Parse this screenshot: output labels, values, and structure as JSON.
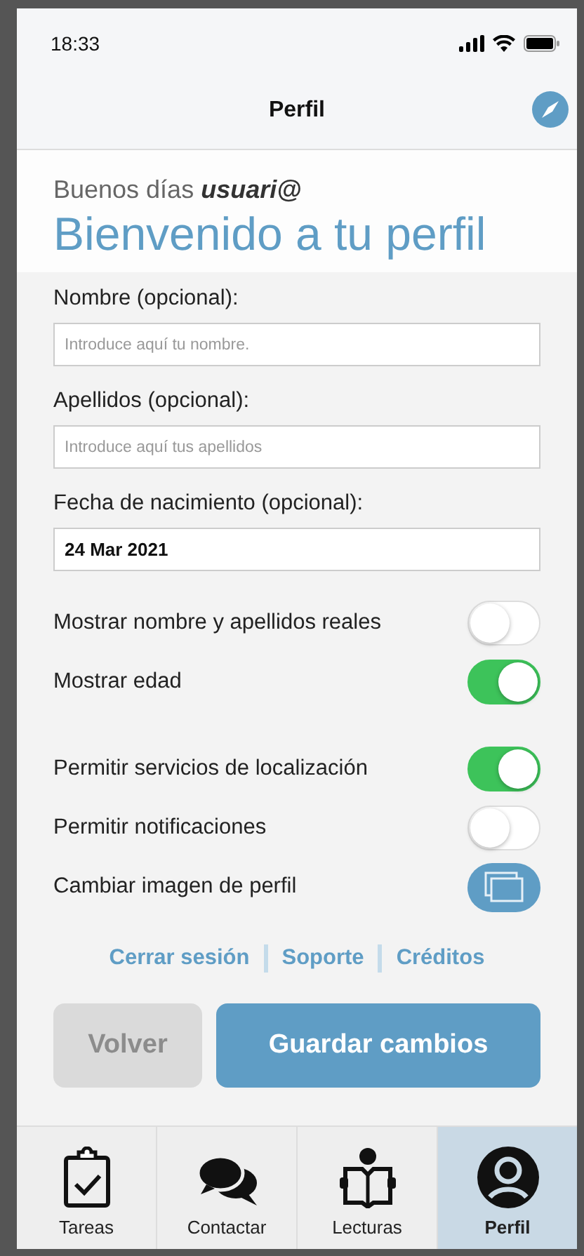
{
  "status_bar": {
    "time": "18:33"
  },
  "header": {
    "title": "Perfil"
  },
  "welcome": {
    "greeting": "Buenos días **usuari@**",
    "title": "Bienvenido a tu perfil"
  },
  "fields": [
    {
      "label": "Nombre (opcional):",
      "placeholder": "Introduce aquí tu nombre."
    },
    {
      "label": "Apellidos (opcional):",
      "placeholder": "Introduce aquí tus apellidos"
    },
    {
      "label": "Fecha de nacimiento (opcional):",
      "value": "24 Mar 2021"
    }
  ],
  "settings": [
    {
      "kind": "toggle",
      "label": "Mostrar nombre y apellidos reales",
      "on": false
    },
    {
      "kind": "toggle",
      "label": "Mostrar edad",
      "on": true
    },
    {
      "kind": "gap"
    },
    {
      "kind": "toggle",
      "label": "Permitir servicios de localización",
      "on": true
    },
    {
      "kind": "toggle",
      "label": "Permitir notificaciones",
      "on": false
    },
    {
      "kind": "button",
      "label": "Cambiar imagen de perfil"
    }
  ],
  "links": [
    "Cerrar sesión",
    "Soporte",
    "Créditos"
  ],
  "buttons": [
    {
      "label": "Volver",
      "disabled": true
    },
    {
      "label": "Guardar cambios",
      "disabled": false
    }
  ],
  "tabs": [
    {
      "label": "Tareas",
      "selected": false
    },
    {
      "label": "Contactar",
      "selected": false
    },
    {
      "label": "Lecturas",
      "selected": false
    },
    {
      "label": "Perfil",
      "selected": true
    }
  ]
}
